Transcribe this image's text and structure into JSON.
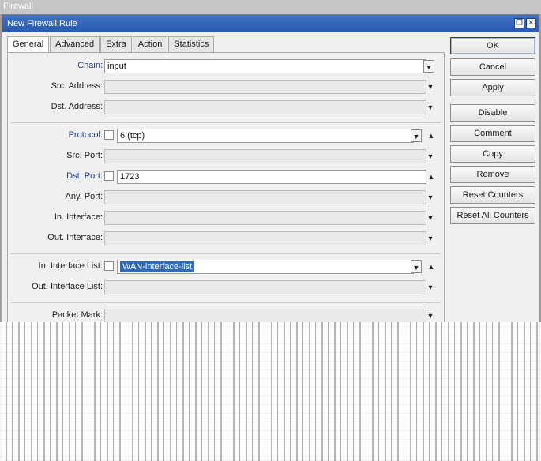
{
  "app": {
    "outer_title": "Firewall"
  },
  "dialog": {
    "title": "New Firewall Rule",
    "restore_glyph": "❐",
    "close_glyph": "✕"
  },
  "tabs": [
    {
      "label": "General",
      "active": true
    },
    {
      "label": "Advanced"
    },
    {
      "label": "Extra"
    },
    {
      "label": "Action"
    },
    {
      "label": "Statistics"
    }
  ],
  "fields": {
    "chain": {
      "label": "Chain:",
      "value": "input"
    },
    "src_address": {
      "label": "Src. Address:",
      "value": ""
    },
    "dst_address": {
      "label": "Dst. Address:",
      "value": ""
    },
    "protocol": {
      "label": "Protocol:",
      "value": "6 (tcp)"
    },
    "src_port": {
      "label": "Src. Port:",
      "value": ""
    },
    "dst_port": {
      "label": "Dst. Port:",
      "value": "1723"
    },
    "any_port": {
      "label": "Any. Port:",
      "value": ""
    },
    "in_interface": {
      "label": "In. Interface:",
      "value": ""
    },
    "out_interface": {
      "label": "Out. Interface:",
      "value": ""
    },
    "in_interface_list": {
      "label": "In. Interface List:",
      "value": "WAN-interface-list"
    },
    "out_interface_list": {
      "label": "Out. Interface List:",
      "value": ""
    },
    "packet_mark": {
      "label": "Packet Mark:",
      "value": ""
    }
  },
  "buttons": {
    "ok": "OK",
    "cancel": "Cancel",
    "apply": "Apply",
    "disable": "Disable",
    "comment": "Comment",
    "copy": "Copy",
    "remove": "Remove",
    "reset_counters": "Reset Counters",
    "reset_all_counters": "Reset All Counters"
  },
  "glyphs": {
    "dropdown": "▼",
    "updown": "▲"
  }
}
